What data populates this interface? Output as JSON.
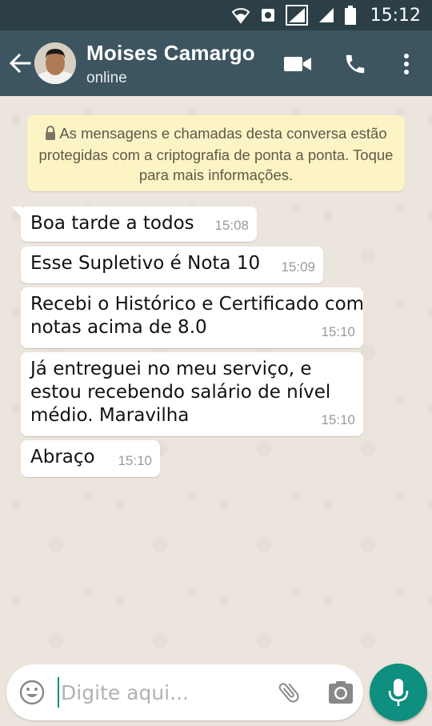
{
  "status_bar": {
    "time": "15:12",
    "icons": [
      "wifi-icon",
      "sync-icon",
      "signal-icon",
      "signal-icon-2",
      "battery-icon"
    ]
  },
  "header": {
    "contact_name": "Moises Camargo",
    "status": "online",
    "actions": [
      "video-call-icon",
      "phone-icon",
      "more-vert-icon"
    ]
  },
  "encryption_notice": {
    "text": "As mensagens e chamadas desta conversa estão protegidas com a criptografia de ponta a ponta. Toque para mais informações."
  },
  "messages": [
    {
      "text": "Boa tarde a todos",
      "time": "15:08"
    },
    {
      "text": "Esse Supletivo é Nota 10",
      "time": "15:09"
    },
    {
      "text": "Recebi o Histórico e Certificado com notas acima de 8.0",
      "time": "15:10"
    },
    {
      "text": "Já entreguei no meu serviço, e estou recebendo salário de nível médio. Maravilha",
      "time": "15:10"
    },
    {
      "text": "Abraço",
      "time": "15:10"
    }
  ],
  "composer": {
    "placeholder": "Digite aqui..."
  },
  "colors": {
    "status_bar": "#2c3f47",
    "app_bar": "#3d5560",
    "chat_background": "#ece5dd",
    "notice_background": "#fdf4c5",
    "mic_button": "#0e8f7f"
  }
}
